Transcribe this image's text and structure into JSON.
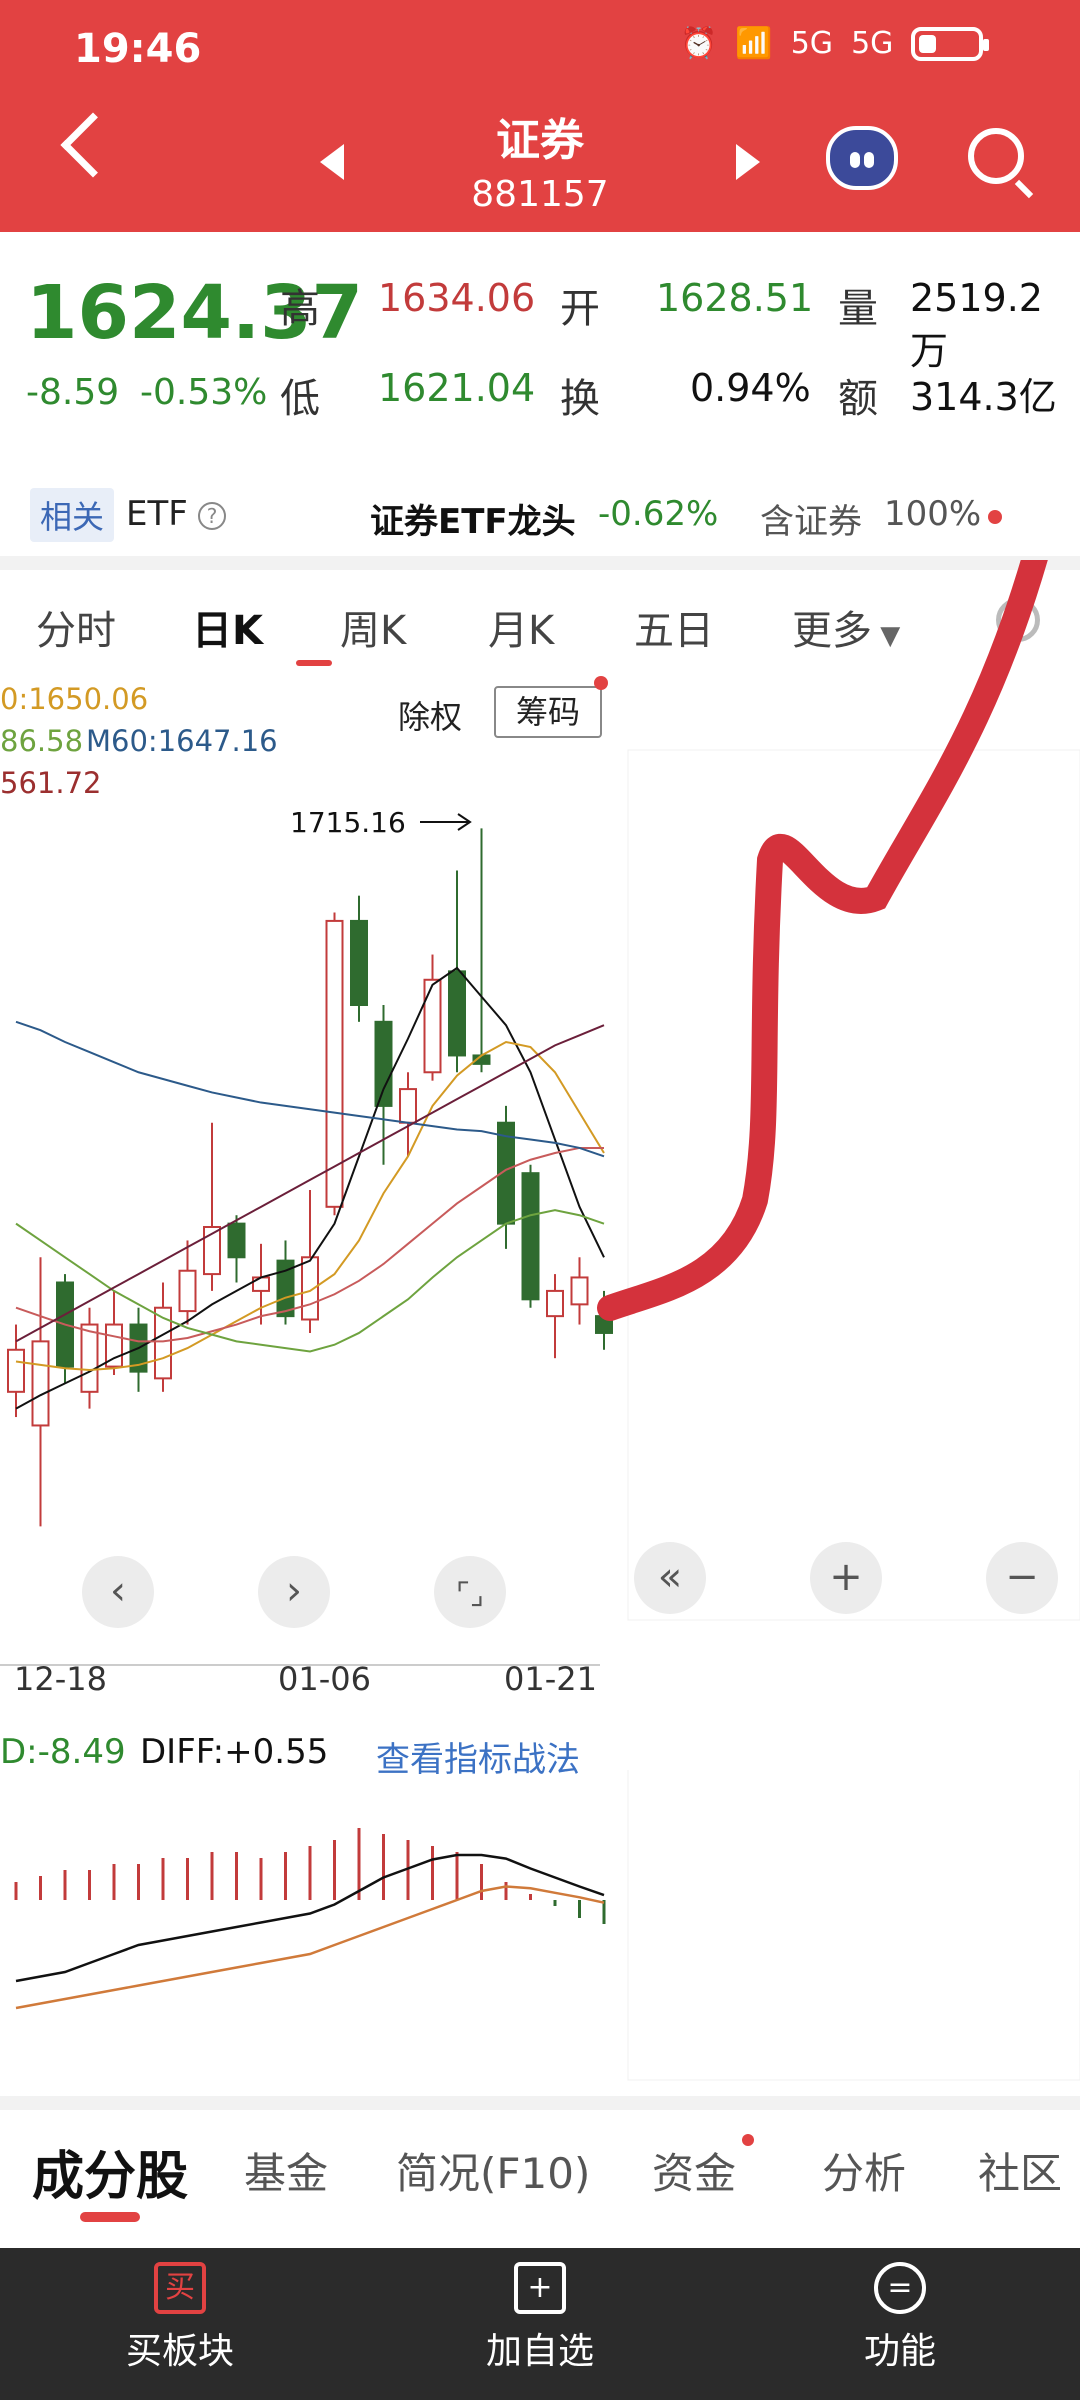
{
  "status": {
    "time": "19:46",
    "net1": "5G",
    "net2": "5G",
    "battery_level": 0.3
  },
  "header": {
    "title": "证券",
    "code": "881157"
  },
  "quote": {
    "price": "1624.37",
    "change": "-8.59",
    "change_pct": "-0.53%",
    "high_label": "高",
    "high": "1634.06",
    "low_label": "低",
    "low": "1621.04",
    "open_label": "开",
    "open": "1628.51",
    "turnover_label": "换",
    "turnover": "0.94%",
    "volume_label": "量",
    "volume": "2519.2万",
    "amount_label": "额",
    "amount": "314.3亿"
  },
  "etf": {
    "tag": "相关",
    "label": "ETF",
    "name": "证券ETF龙头",
    "pct": "-0.62%",
    "contain": "含证券",
    "contain_pct": "100%"
  },
  "tabs": [
    {
      "label": "分时"
    },
    {
      "label": "日K"
    },
    {
      "label": "周K"
    },
    {
      "label": "月K"
    },
    {
      "label": "五日"
    },
    {
      "label": "更多"
    }
  ],
  "chart_controls": {
    "exright": "除权",
    "chips": "筹码"
  },
  "ma_legend": {
    "m1": "0:1650.06",
    "m2": "86.58",
    "m60": "M60:1647.16",
    "m4": "561.72"
  },
  "chart_data": {
    "type": "candlestick",
    "high_annotation": "1715.16",
    "x_ticks": [
      "12-18",
      "01-06",
      "01-21"
    ],
    "candles": [
      {
        "o": 1600,
        "c": 1625,
        "h": 1640,
        "l": 1585
      },
      {
        "o": 1580,
        "c": 1630,
        "h": 1680,
        "l": 1520
      },
      {
        "o": 1665,
        "c": 1615,
        "h": 1670,
        "l": 1605
      },
      {
        "o": 1600,
        "c": 1640,
        "h": 1650,
        "l": 1590
      },
      {
        "o": 1615,
        "c": 1640,
        "h": 1660,
        "l": 1610
      },
      {
        "o": 1640,
        "c": 1612,
        "h": 1650,
        "l": 1600
      },
      {
        "o": 1608,
        "c": 1650,
        "h": 1665,
        "l": 1600
      },
      {
        "o": 1648,
        "c": 1672,
        "h": 1690,
        "l": 1640
      },
      {
        "o": 1670,
        "c": 1698,
        "h": 1760,
        "l": 1660
      },
      {
        "o": 1700,
        "c": 1680,
        "h": 1705,
        "l": 1665
      },
      {
        "o": 1660,
        "c": 1668,
        "h": 1688,
        "l": 1640
      },
      {
        "o": 1678,
        "c": 1645,
        "h": 1690,
        "l": 1640
      },
      {
        "o": 1643,
        "c": 1680,
        "h": 1720,
        "l": 1635
      },
      {
        "o": 1710,
        "c": 1880,
        "h": 1885,
        "l": 1705
      },
      {
        "o": 1880,
        "c": 1830,
        "h": 1895,
        "l": 1820
      },
      {
        "o": 1820,
        "c": 1770,
        "h": 1830,
        "l": 1735
      },
      {
        "o": 1760,
        "c": 1780,
        "h": 1790,
        "l": 1740
      },
      {
        "o": 1790,
        "c": 1845,
        "h": 1860,
        "l": 1785
      },
      {
        "o": 1850,
        "c": 1800,
        "h": 1910,
        "l": 1790
      },
      {
        "o": 1800,
        "c": 1795,
        "h": 1935,
        "l": 1790
      },
      {
        "o": 1760,
        "c": 1700,
        "h": 1770,
        "l": 1685
      },
      {
        "o": 1730,
        "c": 1655,
        "h": 1735,
        "l": 1650
      },
      {
        "o": 1645,
        "c": 1660,
        "h": 1670,
        "l": 1620
      },
      {
        "o": 1652,
        "c": 1668,
        "h": 1680,
        "l": 1640
      },
      {
        "o": 1645,
        "c": 1635,
        "h": 1660,
        "l": 1625
      }
    ],
    "ma_lines": [
      {
        "color": "#111111",
        "values": [
          1590,
          1598,
          1605,
          1612,
          1620,
          1626,
          1634,
          1642,
          1652,
          1660,
          1668,
          1672,
          1678,
          1700,
          1740,
          1780,
          1810,
          1842,
          1852,
          1835,
          1818,
          1790,
          1750,
          1710,
          1680
        ]
      },
      {
        "color": "#d39a24",
        "values": [
          1618,
          1616,
          1614,
          1613,
          1614,
          1616,
          1620,
          1626,
          1634,
          1642,
          1650,
          1656,
          1660,
          1670,
          1690,
          1718,
          1740,
          1770,
          1788,
          1800,
          1808,
          1805,
          1790,
          1766,
          1742
        ]
      },
      {
        "color": "#c85b5b",
        "values": [
          1650,
          1645,
          1640,
          1636,
          1633,
          1630,
          1630,
          1632,
          1636,
          1640,
          1645,
          1648,
          1652,
          1658,
          1666,
          1676,
          1688,
          1700,
          1712,
          1722,
          1732,
          1738,
          1742,
          1745,
          1745
        ]
      },
      {
        "color": "#6ea33f",
        "values": [
          1700,
          1690,
          1680,
          1670,
          1660,
          1652,
          1644,
          1638,
          1634,
          1630,
          1628,
          1626,
          1624,
          1628,
          1635,
          1645,
          1655,
          1668,
          1680,
          1690,
          1700,
          1705,
          1708,
          1705,
          1700
        ]
      },
      {
        "color": "#2c5a8a",
        "values": [
          1820,
          1815,
          1808,
          1802,
          1796,
          1790,
          1786,
          1782,
          1778,
          1775,
          1772,
          1770,
          1768,
          1766,
          1764,
          1762,
          1760,
          1758,
          1756,
          1755,
          1752,
          1750,
          1748,
          1745,
          1740
        ]
      },
      {
        "color": "#6b1f3a",
        "values": [
          1630,
          1638,
          1646,
          1654,
          1662,
          1670,
          1678,
          1686,
          1694,
          1702,
          1710,
          1718,
          1726,
          1734,
          1742,
          1750,
          1758,
          1766,
          1774,
          1782,
          1790,
          1798,
          1806,
          1812,
          1818
        ]
      }
    ],
    "macd": {
      "dea_label": "D:-8.49",
      "diff_label": "DIFF:+0.55",
      "bars": [
        3,
        4,
        5,
        5,
        6,
        6,
        7,
        7,
        8,
        8,
        7,
        8,
        9,
        10,
        12,
        11,
        10,
        9,
        8,
        6,
        3,
        1,
        -1,
        -3,
        -4
      ],
      "diff": [
        -9,
        -8.5,
        -8,
        -7,
        -6,
        -5,
        -4.5,
        -4,
        -3.5,
        -3,
        -2.5,
        -2,
        -1.5,
        -0.5,
        1,
        2.5,
        3.5,
        4.5,
        5,
        5,
        4.6,
        3.5,
        2.5,
        1.5,
        0.55
      ],
      "dea": [
        -12,
        -11.5,
        -11,
        -10.5,
        -10,
        -9.5,
        -9,
        -8.5,
        -8,
        -7.5,
        -7,
        -6.5,
        -6,
        -5,
        -4,
        -3,
        -2,
        -1,
        0,
        1,
        1.5,
        1.3,
        0.8,
        0.3,
        -0.3
      ]
    }
  },
  "macd_link": "查看指标战法",
  "bottom_tabs": [
    {
      "label": "成分股"
    },
    {
      "label": "基金"
    },
    {
      "label": "简况(F10)"
    },
    {
      "label": "资金"
    },
    {
      "label": "分析"
    },
    {
      "label": "社区"
    }
  ],
  "bottom_bar": [
    {
      "icon": "买",
      "label": "买板块"
    },
    {
      "icon": "+",
      "label": "加自选"
    },
    {
      "icon": "=",
      "label": "功能"
    }
  ],
  "colors": {
    "brand_red": "#e24242",
    "up": "#c23b3b",
    "down": "#2f6b2f"
  }
}
